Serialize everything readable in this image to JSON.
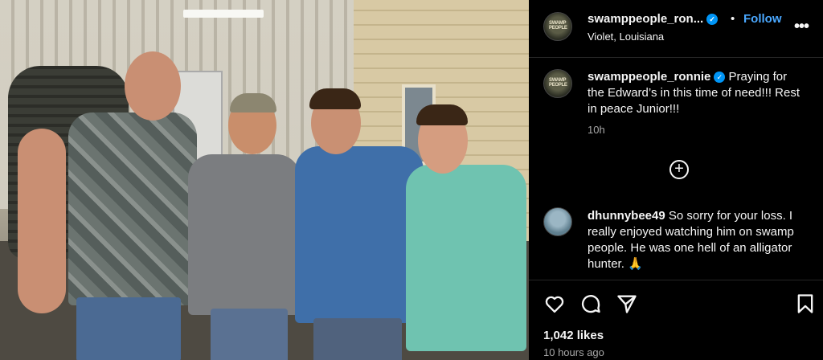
{
  "post": {
    "username": "swamppeople_ron...",
    "location": "Violet, Louisiana",
    "follow_label": "Follow",
    "separator": "•",
    "more_icon": "more-horizontal-icon",
    "avatar_text": "SWAMP PEOPLE"
  },
  "caption": {
    "username": "swamppeople_ronnie",
    "text": "Praying for the Edward’s in this time of need!!! Rest in peace Junior!!!",
    "time": "10h"
  },
  "load_more": {
    "icon": "plus-circle-icon"
  },
  "comments": [
    {
      "username": "dhunnybee49",
      "text": "So sorry for your loss. I really enjoyed watching him on swamp people. He was one hell of an alligator hunter. 🙏"
    }
  ],
  "actions": {
    "like_icon": "heart-icon",
    "comment_icon": "comment-icon",
    "share_icon": "send-icon",
    "save_icon": "bookmark-icon",
    "likes": "1,042 likes",
    "time_ago": "10 hours ago"
  },
  "colors": {
    "background": "#000000",
    "accent": "#4aa8ff",
    "verified": "#0095f6",
    "muted": "#a8a8a8"
  }
}
